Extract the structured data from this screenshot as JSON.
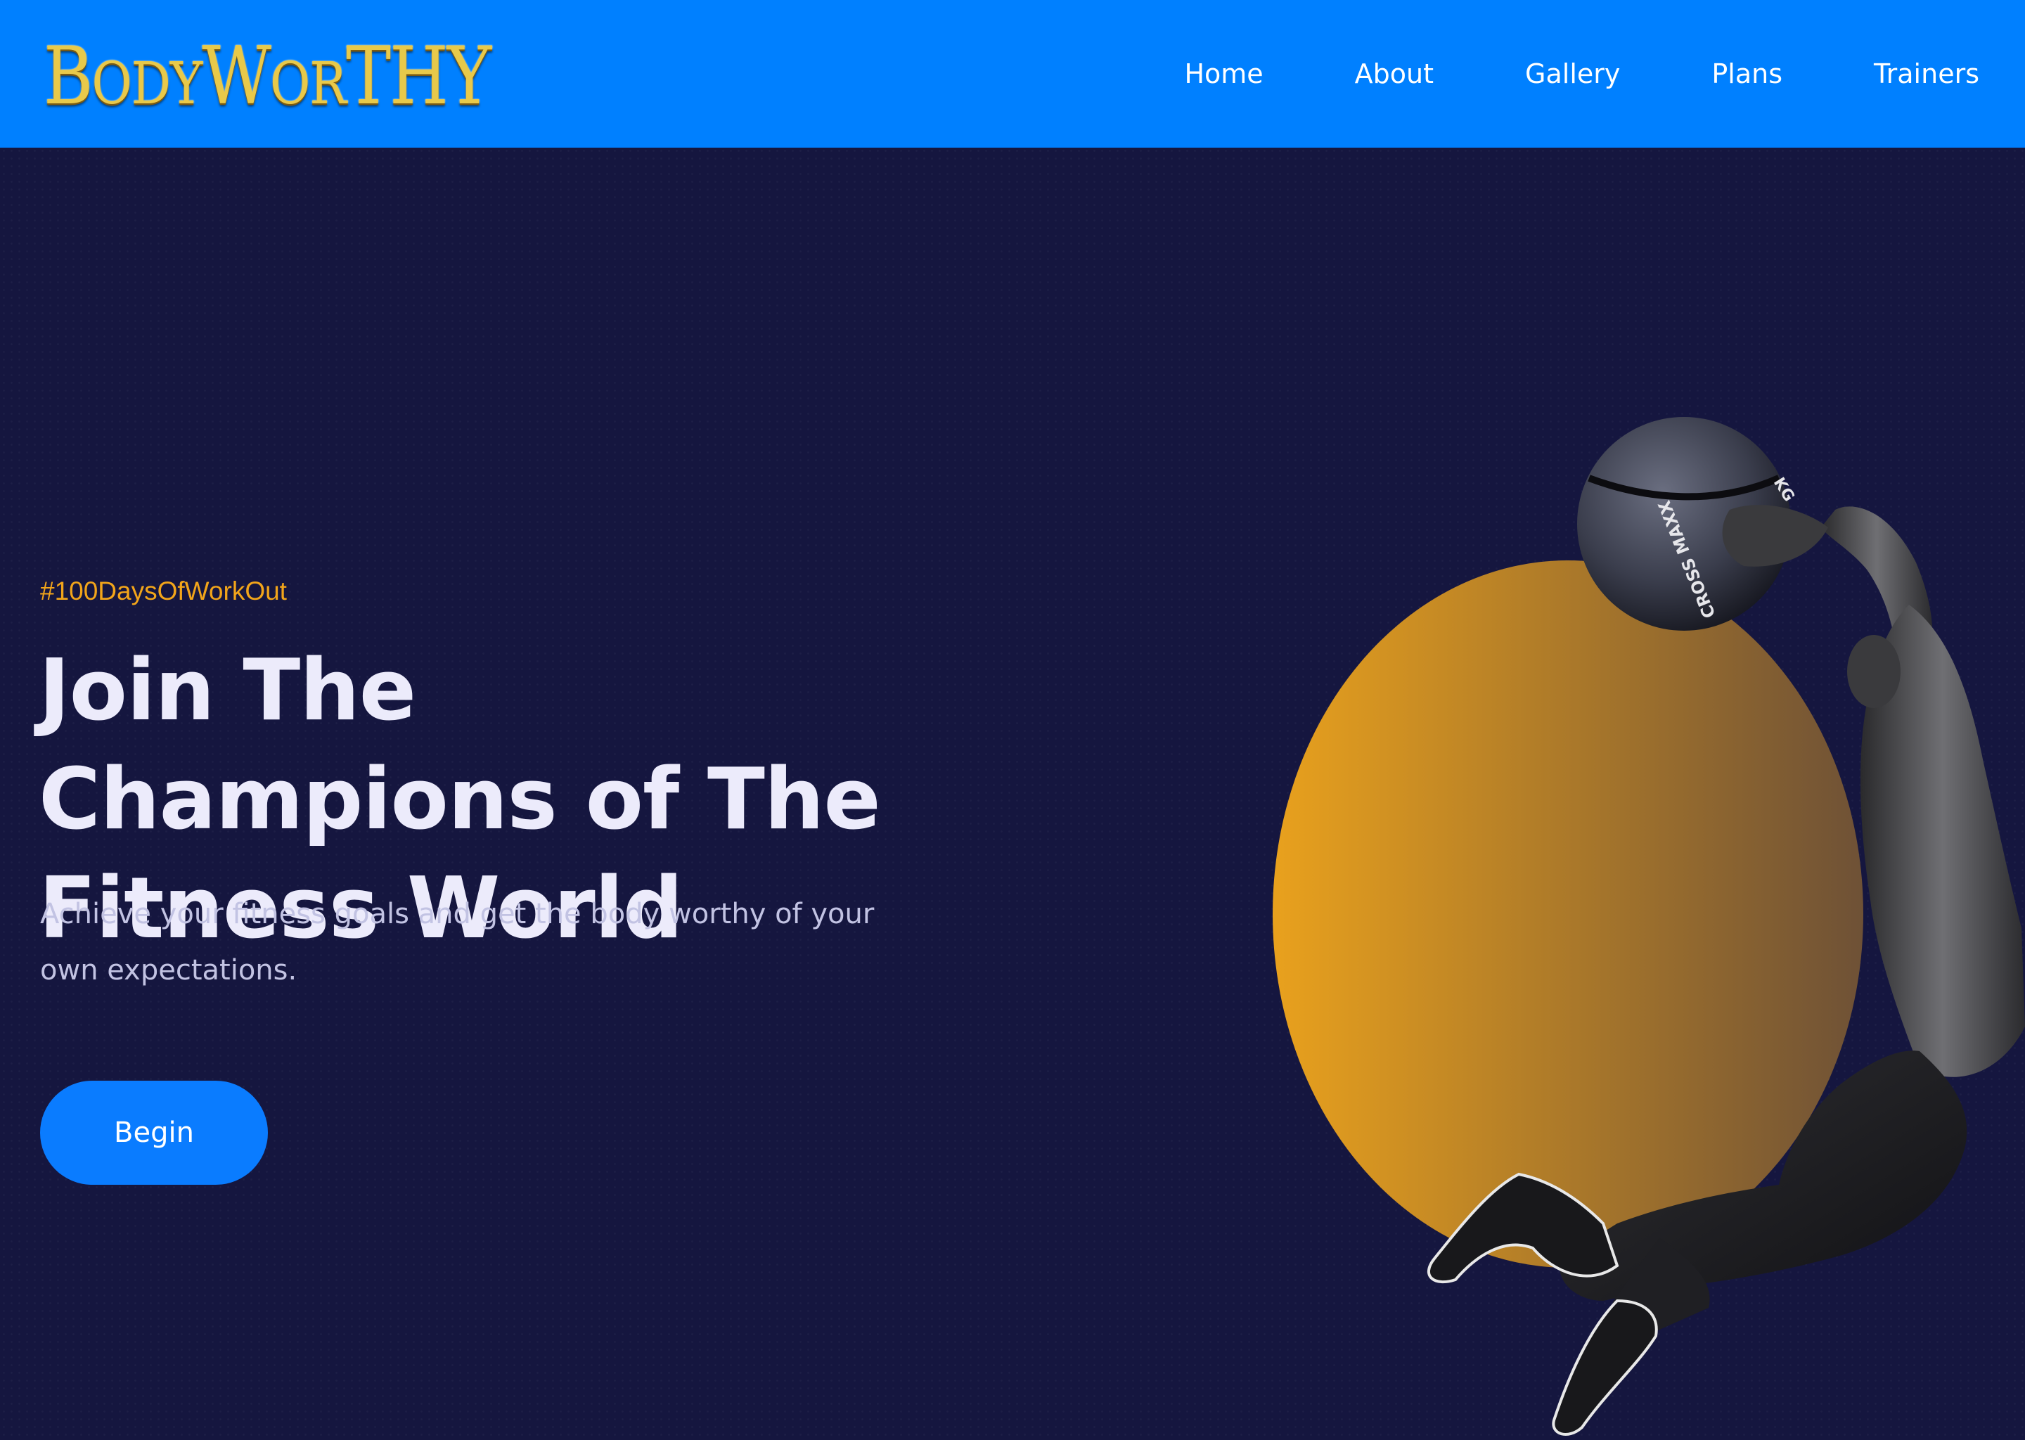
{
  "header": {
    "logo_big_1": "B",
    "logo_small_1": "ODY",
    "logo_big_2": "W",
    "logo_small_2": "OR",
    "logo_big_3": "THY",
    "nav": [
      "Home",
      "About",
      "Gallery",
      "Plans",
      "Trainers"
    ]
  },
  "hero": {
    "hashtag": "#100DaysOfWorkOut",
    "headline": "Join The Champions of The Fitness World",
    "subtext": "Achieve your fitness goals and get the body worthy of your own expectations.",
    "button_label": "Begin",
    "ball_text": "CROSS MAXX",
    "ball_weight": "KG"
  },
  "colors": {
    "header_bg": "#0080ff",
    "page_bg": "#15163f",
    "accent_orange": "#f2a51a",
    "button_bg": "#0a7cff",
    "logo_gold": "#e8c94a"
  }
}
